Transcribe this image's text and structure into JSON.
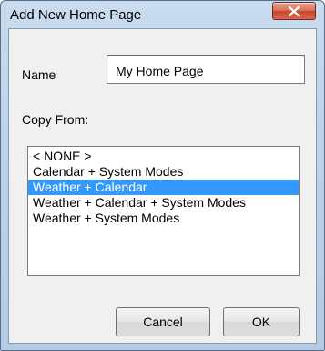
{
  "window": {
    "title": "Add New Home Page",
    "close_icon": "close-icon"
  },
  "form": {
    "name_label": "Name",
    "name_value": "My Home Page",
    "copy_from_label": "Copy From:"
  },
  "list": {
    "items": [
      {
        "label": "< NONE >",
        "selected": false
      },
      {
        "label": "Calendar + System Modes",
        "selected": false
      },
      {
        "label": "Weather + Calendar",
        "selected": true
      },
      {
        "label": "Weather + Calendar + System Modes",
        "selected": false
      },
      {
        "label": "Weather + System Modes",
        "selected": false
      }
    ]
  },
  "buttons": {
    "cancel_label": "Cancel",
    "ok_label": "OK"
  },
  "colors": {
    "selection": "#3399ff",
    "close_button": "#c7452b"
  }
}
